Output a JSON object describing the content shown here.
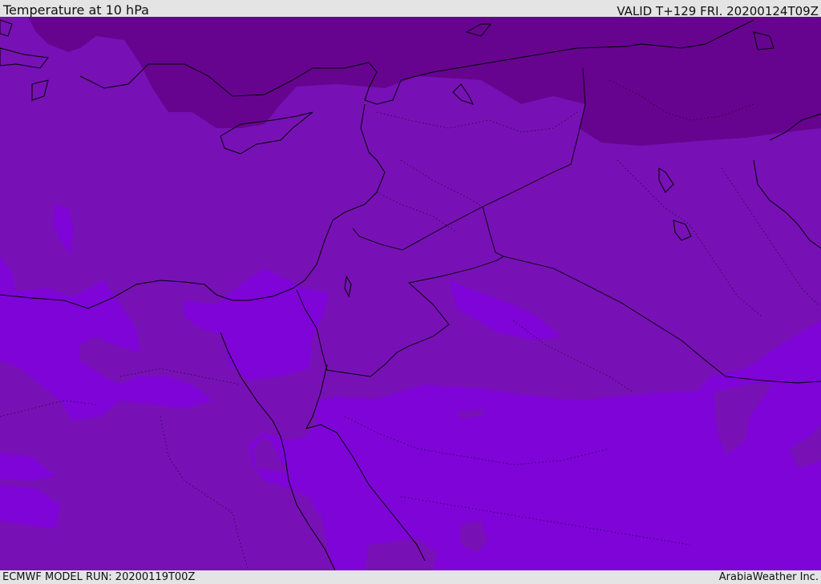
{
  "header": {
    "title": "Temperature at 10 hPa",
    "valid": "VALID T+129 FRI. 20200124T09Z"
  },
  "footer": {
    "model_run": "ECMWF MODEL RUN: 20200119T00Z",
    "credit": "ArabiaWeather Inc."
  },
  "map": {
    "field": "temperature",
    "pressure_level": "10 hPa",
    "region": "Eastern Mediterranean / Middle East",
    "colors": {
      "coldest": "#66048f",
      "mid": "#7711b5",
      "warm": "#7e04d8",
      "warmest": "#8b00f2",
      "coastline": "#000000"
    }
  }
}
